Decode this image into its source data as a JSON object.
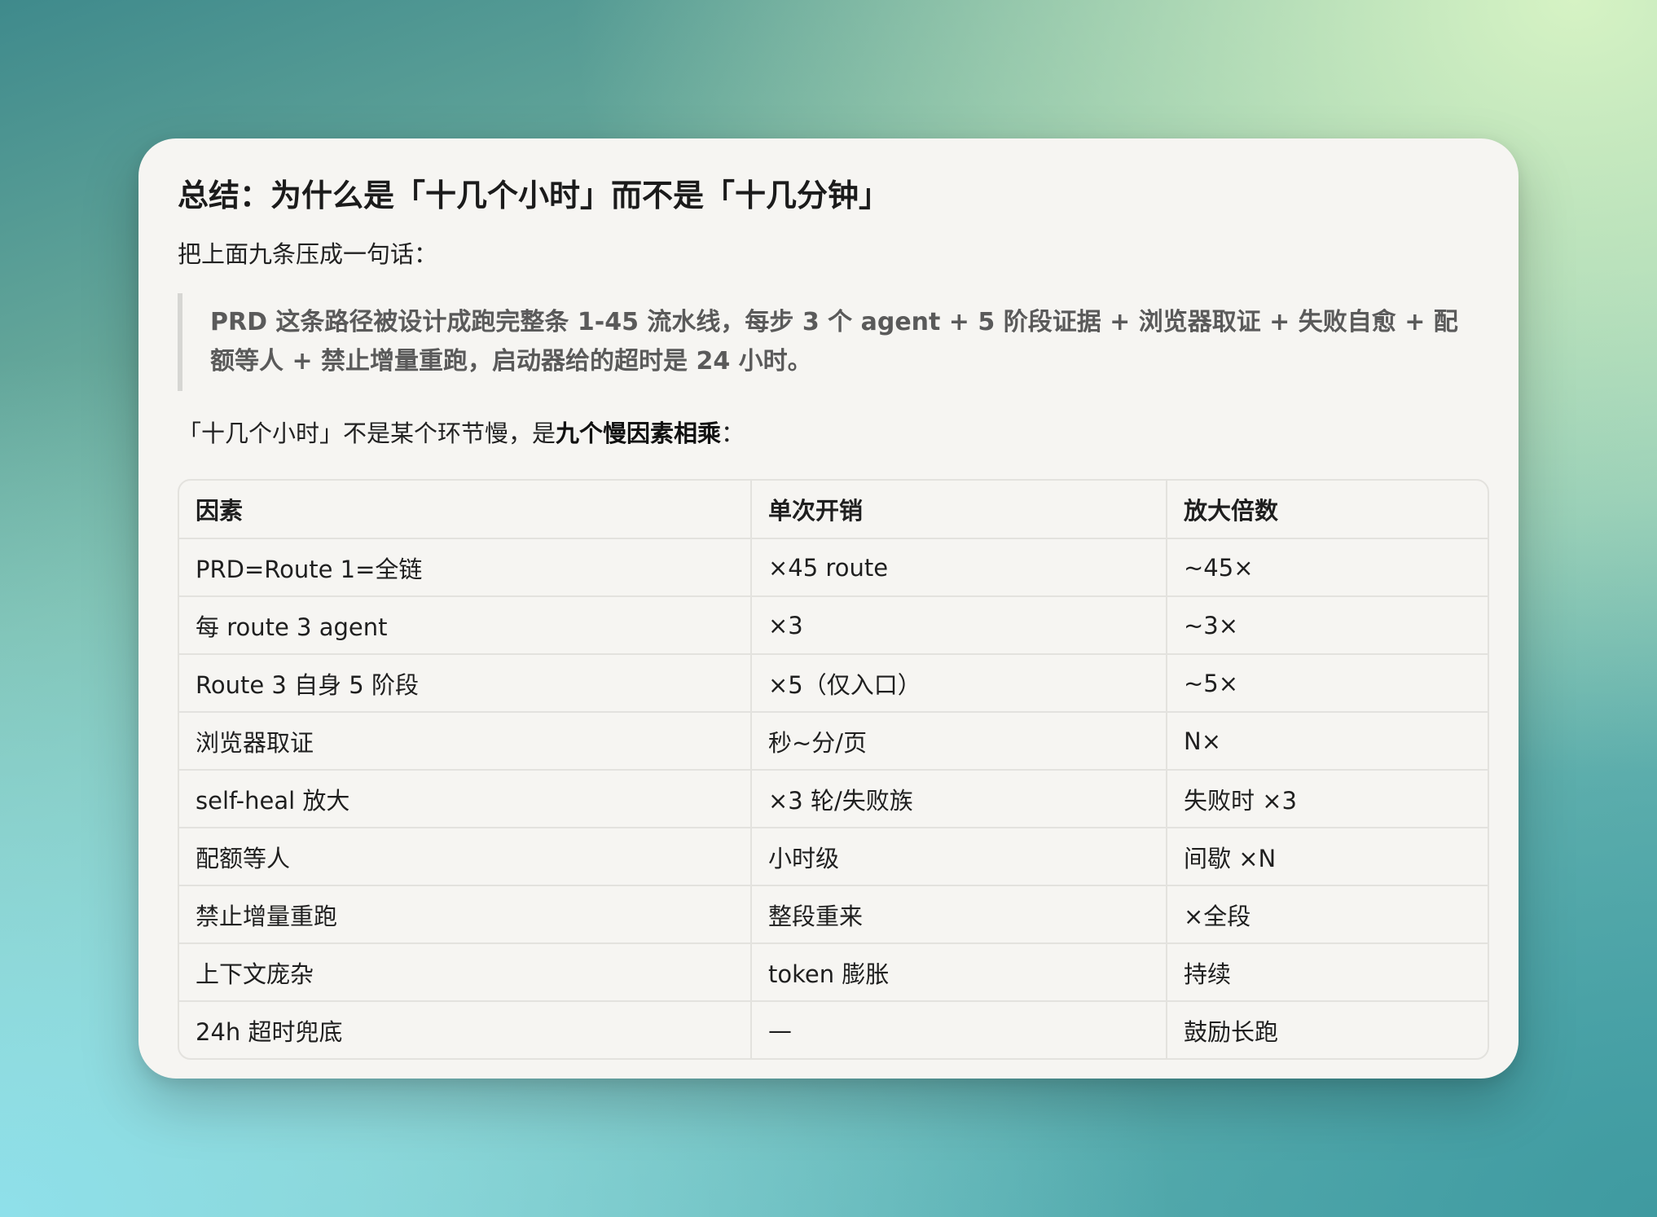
{
  "title": "总结：为什么是「十几个小时」而不是「十几分钟」",
  "intro": "把上面九条压成一句话：",
  "quote": "PRD 这条路径被设计成跑完整条 1-45 流水线，每步 3 个 agent + 5 阶段证据 + 浏览器取证 + 失败自愈 + 配额等人 + 禁止增量重跑，启动器给的超时是 24 小时。",
  "lead": {
    "prefix": "「十几个小时」不是某个环节慢，是",
    "bold": "九个慢因素相乘",
    "suffix": "："
  },
  "table": {
    "headers": [
      "因素",
      "单次开销",
      "放大倍数"
    ],
    "rows": [
      [
        "PRD=Route 1=全链",
        "×45 route",
        "~45×"
      ],
      [
        "每 route 3 agent",
        "×3",
        "~3×"
      ],
      [
        "Route 3 自身 5 阶段",
        "×5（仅入口）",
        "~5×"
      ],
      [
        "浏览器取证",
        "秒~分/页",
        "N×"
      ],
      [
        "self-heal 放大",
        "×3 轮/失败族",
        "失败时 ×3"
      ],
      [
        "配额等人",
        "小时级",
        "间歇 ×N"
      ],
      [
        "禁止增量重跑",
        "整段重来",
        "×全段"
      ],
      [
        "上下文庞杂",
        "token 膨胀",
        "持续"
      ],
      [
        "24h 超时兜底",
        "—",
        "鼓励长跑"
      ]
    ]
  }
}
